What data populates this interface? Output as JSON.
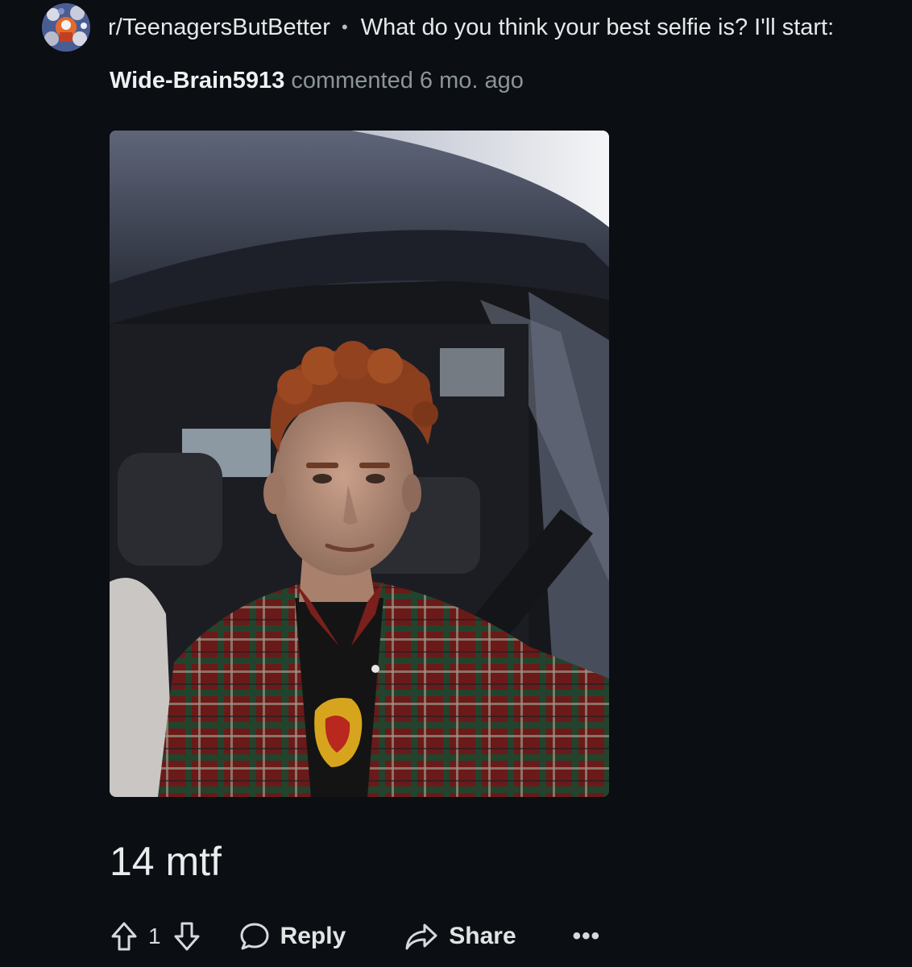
{
  "header": {
    "subreddit": "r/TeenagersButBetter",
    "separator": "•",
    "post_title": "What do you think your best selfie is? I'll start:"
  },
  "comment": {
    "author": "Wide-Brain5913",
    "meta": "commented 6 mo. ago",
    "body": "14 mtf",
    "image_description_icon": "selfie-photo"
  },
  "actions": {
    "vote_count": "1",
    "reply_label": "Reply",
    "share_label": "Share",
    "more_label": "•••"
  },
  "colors": {
    "background": "#0b0e12",
    "primary_text": "#e6e8ea",
    "secondary_text": "#8b949b"
  }
}
